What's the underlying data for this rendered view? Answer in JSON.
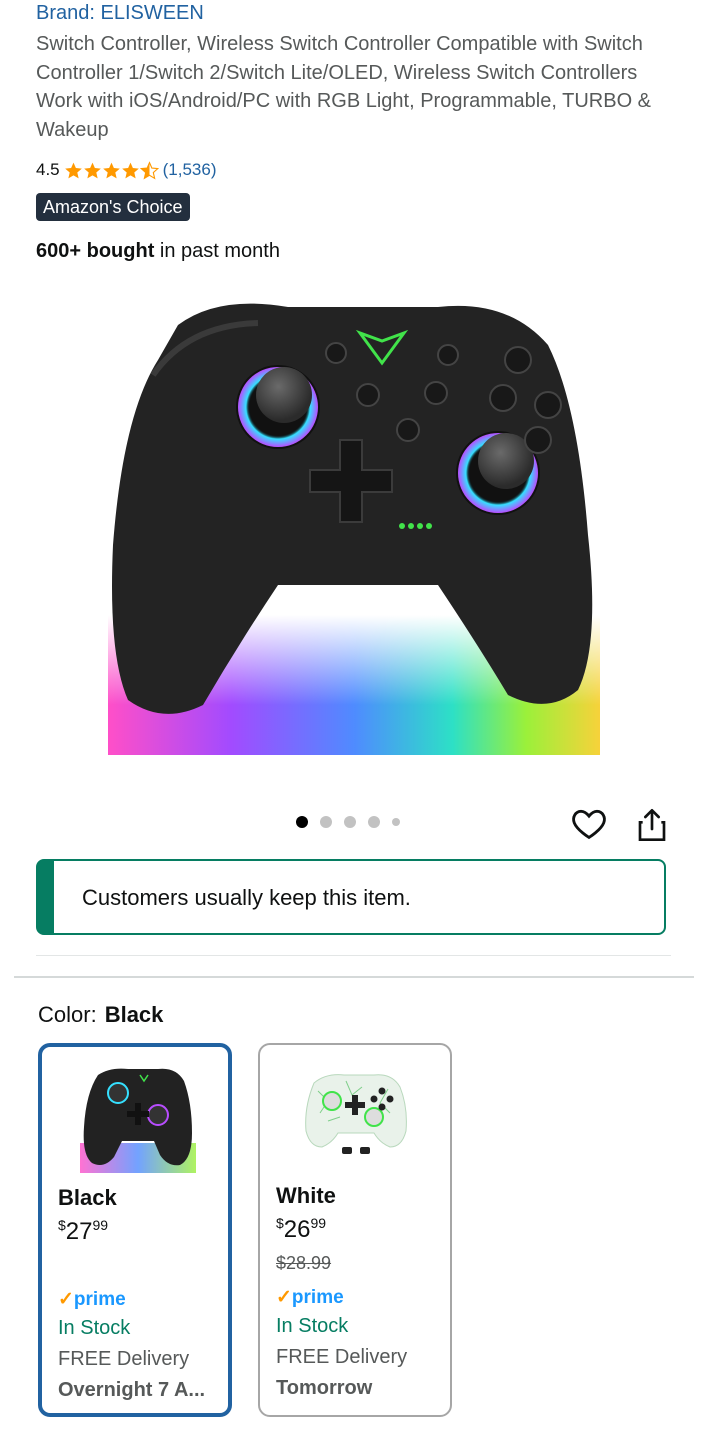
{
  "product": {
    "brand": "Brand: ELISWEEN",
    "title": "Switch Controller, Wireless Switch Controller Compatible with Switch Controller 1/Switch 2/Switch Lite/OLED, Wireless Switch Controllers Work with iOS/Android/PC with RGB Light, Programmable, TURBO & Wakeup",
    "rating": "4.5",
    "rating_stars": 4.5,
    "review_count": "(1,536)",
    "badge": "Amazon's Choice",
    "bought_strong": "600+ bought",
    "bought_rest": " in past month",
    "image_count": 5,
    "active_image": 1
  },
  "notice": {
    "text": "Customers usually keep this item."
  },
  "color_selector": {
    "label": "Color:",
    "selected": "Black",
    "options": [
      {
        "name": "Black",
        "price_symbol": "$",
        "price_whole": "27",
        "price_fraction": "99",
        "list_price": "",
        "prime": "prime",
        "stock": "In Stock",
        "delivery": "FREE Delivery",
        "delivery_time": "Overnight 7 A..."
      },
      {
        "name": "White",
        "price_symbol": "$",
        "price_whole": "26",
        "price_fraction": "99",
        "list_price": "$28.99",
        "prime": "prime",
        "stock": "In Stock",
        "delivery": "FREE Delivery",
        "delivery_time": "Tomorrow"
      }
    ]
  },
  "icons": {
    "wishlist": "heart-icon",
    "share": "share-icon"
  },
  "colors": {
    "link": "#2162a1",
    "star": "#ff9900",
    "green": "#067d62",
    "badge_bg": "#232f3e",
    "prime": "#1a98ff"
  }
}
